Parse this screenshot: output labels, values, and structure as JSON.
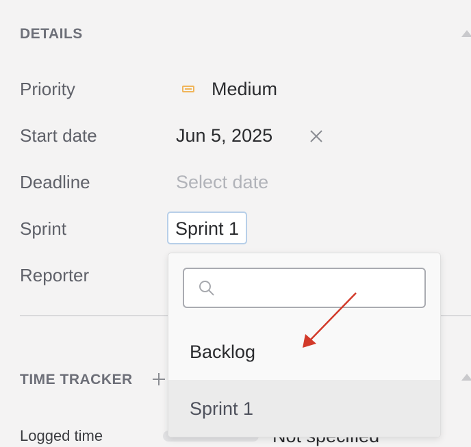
{
  "details": {
    "title": "DETAILS",
    "fields": {
      "priority": {
        "label": "Priority",
        "value": "Medium",
        "icon": "priority-medium-icon",
        "icon_color": "#f0b45a"
      },
      "start_date": {
        "label": "Start date",
        "value": "Jun 5, 2025"
      },
      "deadline": {
        "label": "Deadline",
        "placeholder": "Select date"
      },
      "sprint": {
        "label": "Sprint",
        "value": "Sprint 1"
      },
      "reporter": {
        "label": "Reporter"
      }
    }
  },
  "time_tracker": {
    "title": "TIME TRACKER",
    "logged_time_label": "Logged time",
    "logged_time_value": "Not specified"
  },
  "sprint_dropdown": {
    "search_placeholder": "",
    "options": [
      {
        "label": "Backlog",
        "selected": false
      },
      {
        "label": "Sprint 1",
        "selected": true
      }
    ]
  },
  "colors": {
    "background": "#f4f3f3",
    "accent_border": "#b7cfe9",
    "annotation_arrow": "#d23a2a"
  }
}
